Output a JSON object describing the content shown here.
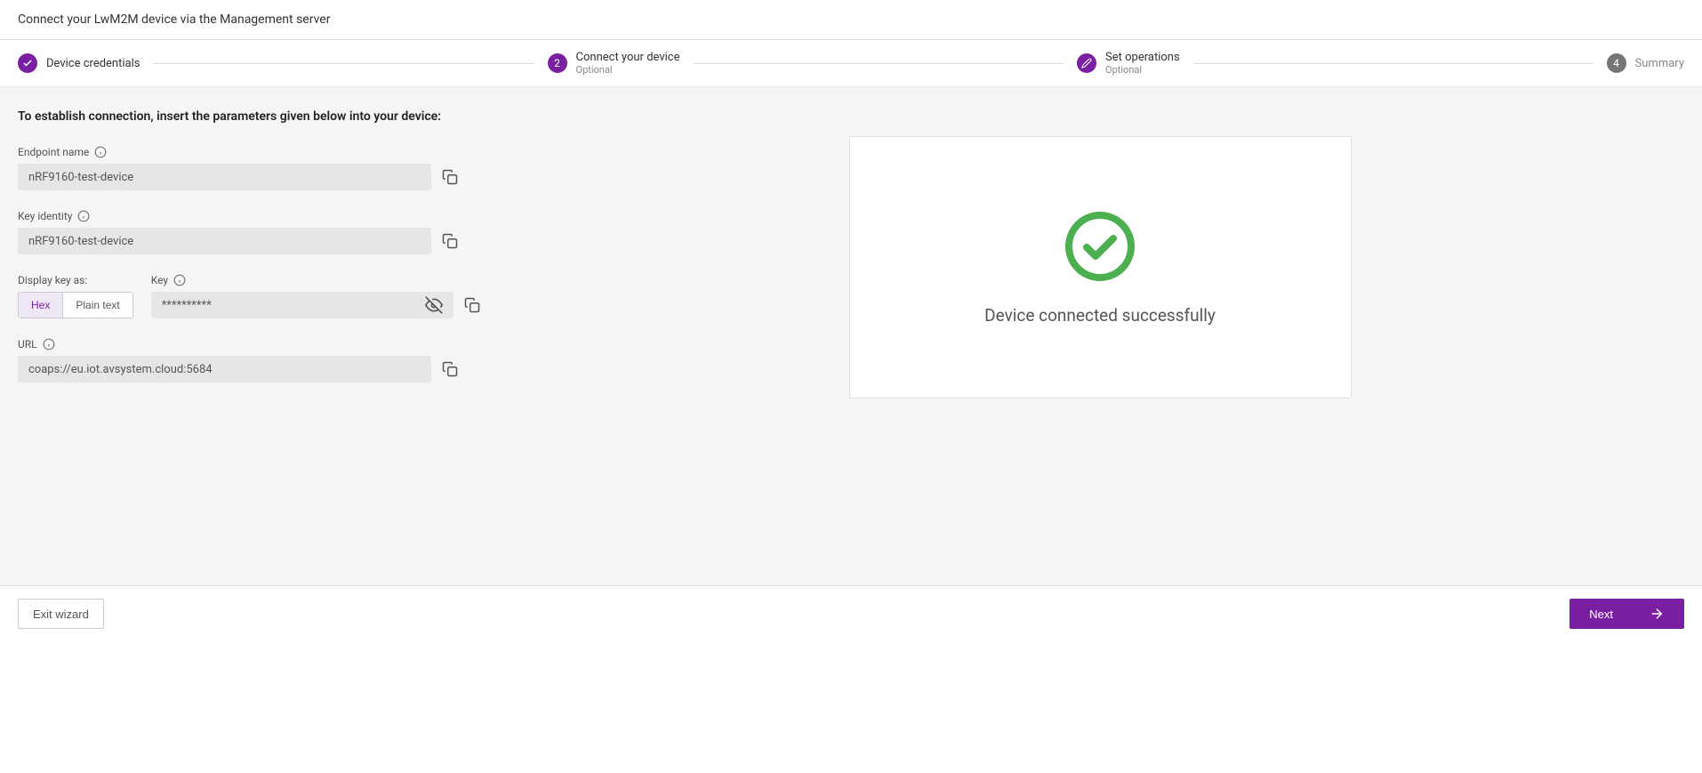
{
  "header": {
    "title": "Connect your LwM2M device via the Management server"
  },
  "stepper": {
    "steps": [
      {
        "label": "Device credentials",
        "sublabel": "",
        "state": "completed"
      },
      {
        "label": "Connect your device",
        "sublabel": "Optional",
        "state": "active",
        "number": "2"
      },
      {
        "label": "Set operations",
        "sublabel": "Optional",
        "state": "completed"
      },
      {
        "label": "Summary",
        "sublabel": "",
        "state": "pending",
        "number": "4"
      }
    ]
  },
  "content": {
    "instruction": "To establish connection, insert the parameters given below into your device:",
    "endpoint": {
      "label": "Endpoint name",
      "value": "nRF9160-test-device"
    },
    "keyIdentity": {
      "label": "Key identity",
      "value": "nRF9160-test-device"
    },
    "displayKeyAs": {
      "label": "Display key as:",
      "options": {
        "hex": "Hex",
        "plain": "Plain text"
      }
    },
    "key": {
      "label": "Key",
      "value": "**********"
    },
    "url": {
      "label": "URL",
      "value": "coaps://eu.iot.avsystem.cloud:5684"
    },
    "success": {
      "message": "Device connected successfully"
    }
  },
  "footer": {
    "exit": "Exit wizard",
    "next": "Next"
  }
}
